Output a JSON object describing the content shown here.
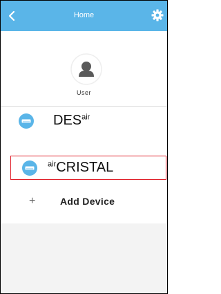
{
  "colors": {
    "header_bg": "#5ab5e8",
    "accent": "#5ab5e8",
    "highlight_border": "#e0202a"
  },
  "header": {
    "title": "Home",
    "back_icon": "chevron-left-icon",
    "settings_icon": "gear-icon"
  },
  "profile": {
    "avatar_icon": "user-avatar-icon",
    "label": "User"
  },
  "devices": [
    {
      "name_main": "DES",
      "name_sup": "air",
      "sup_position": "after",
      "icon": "air-conditioner-icon"
    },
    {
      "name_main": "CRISTAL",
      "name_sup": "air",
      "sup_position": "before",
      "icon": "air-conditioner-icon",
      "highlighted": true
    }
  ],
  "add_device": {
    "icon": "plus-icon",
    "label": "Add Device"
  }
}
